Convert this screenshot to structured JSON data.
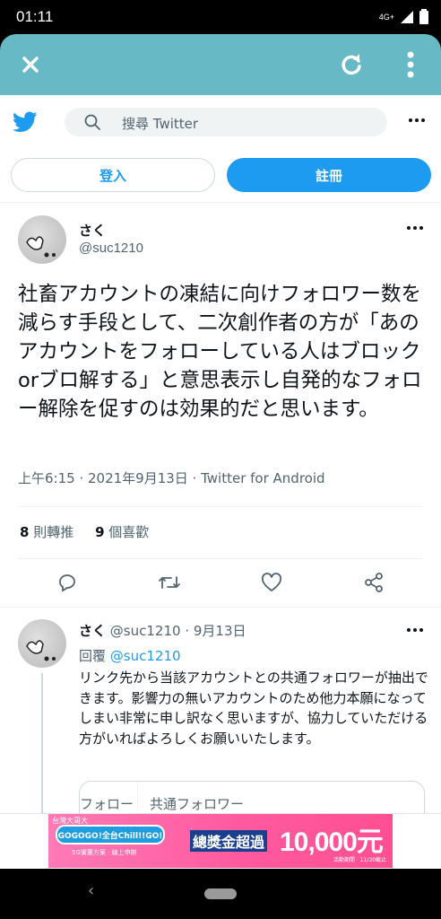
{
  "status_bar": {
    "time": "01:11",
    "network": "4G+"
  },
  "browser": {
    "close_icon": "close-icon",
    "refresh_icon": "refresh-icon",
    "menu_icon": "kebab-icon"
  },
  "twitter": {
    "search_placeholder": "搜尋 Twitter",
    "login_label": "登入",
    "signup_label": "註冊",
    "brand_color": "#1d9bf0"
  },
  "tweet": {
    "author_name": "さく",
    "author_handle": "@suc1210",
    "text": "社畜アカウントの凍結に向けフォロワー数を減らす手段として、二次創作者の方が「あのアカウントをフォローしている人はブロックorブロ解する」と意思表示し自発的なフォロー解除を促すのは効果的だと思います。",
    "timestamp": "上午6:15 · 2021年9月13日 · Twitter for Android",
    "retweets_count": "8",
    "retweets_label": "則轉推",
    "likes_count": "9",
    "likes_label": "個喜歡"
  },
  "reply": {
    "author_name": "さく",
    "author_handle": "@suc1210",
    "date": "· 9月13日",
    "replying_label": "回覆",
    "replying_to": "@suc1210",
    "text": "リンク先から当該アカウントとの共通フォロワーが抽出できます。影響力の無いアカウントのため他力本願になってしまい非常に申し訳なく思いますが、協力していただける方がいればよろしくお願いいたします。",
    "card_left": "フォロー",
    "card_right": "共通フォロワー"
  },
  "ad": {
    "brand": "台灣大哥大",
    "pill_text": "GOGOGO!全台Chill!!GO!",
    "sub_text": "5G實惠方案 · 線上申辦",
    "main_text_1": "總獎金超過",
    "main_text_2": "10,000元",
    "footnote": "活動期間 · 11/30截止"
  }
}
